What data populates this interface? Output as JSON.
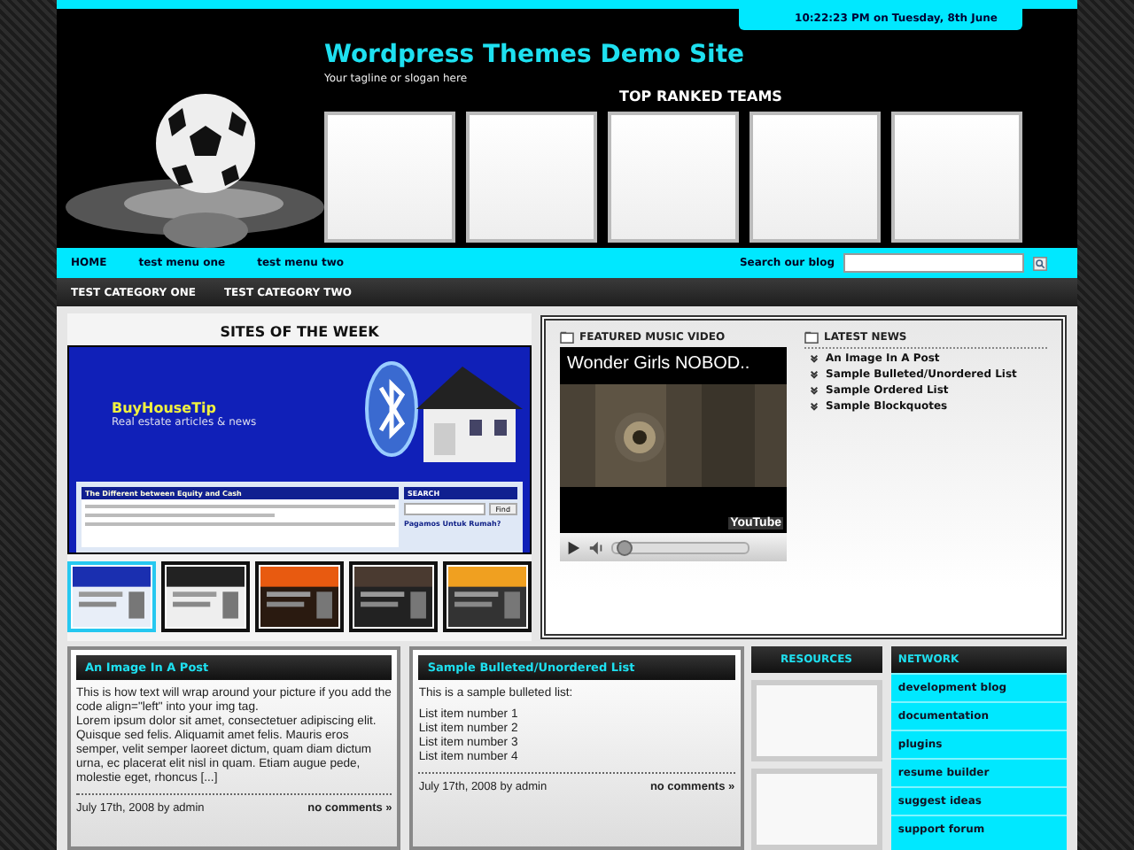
{
  "header": {
    "time": "10:22:23 PM on Tuesday, 8th June",
    "title": "Wordpress Themes Demo Site",
    "tagline": "Your tagline or slogan here",
    "teams_heading": "TOP RANKED TEAMS",
    "teams": [
      {
        "kind": "empty"
      },
      {
        "kind": "empty"
      },
      {
        "kind": "empty"
      },
      {
        "kind": "empty"
      },
      {
        "kind": "empty"
      }
    ]
  },
  "nav": {
    "items": [
      "HOME",
      "test menu one",
      "test menu two"
    ],
    "search_label": "Search our blog"
  },
  "categories": [
    "TEST CATEGORY ONE",
    "TEST CATEGORY TWO"
  ],
  "sites": {
    "heading": "SITES OF THE WEEK",
    "featured": {
      "site_title": "BuyHouseTip",
      "site_tagline": "Real estate articles & news",
      "post_title": "The Different between Equity and Cash",
      "search_label": "SEARCH",
      "search_button": "Find",
      "sidebar_link": "Pagamos Untuk Rumah?"
    },
    "thumbnails": [
      {
        "kind": "blue",
        "selected": true
      },
      {
        "kind": "light",
        "selected": false
      },
      {
        "kind": "orange",
        "selected": false
      },
      {
        "kind": "dark",
        "selected": false
      },
      {
        "kind": "yellow",
        "selected": false
      }
    ]
  },
  "video": {
    "heading": "FEATURED MUSIC VIDEO",
    "title": "Wonder Girls NOBOD..",
    "logo": "YouTube",
    "level": 0.03
  },
  "news": {
    "heading": "LATEST NEWS",
    "items": [
      "An Image In A Post",
      "Sample Bulleted/Unordered List",
      "Sample Ordered List",
      "Sample Blockquotes"
    ]
  },
  "posts": [
    {
      "title": "An Image In A Post",
      "paragraphs": [
        "This is how text will wrap around your picture if you add the code align=\"left\" into your img tag.",
        "Lorem ipsum dolor sit amet, consectetuer adipiscing elit. Quisque sed felis. Aliquamit amet felis. Mauris eros semper, velit semper laoreet dictum, quam diam dictum urna, ec placerat elit nisl in quam. Etiam augue pede, molestie eget, rhoncus [...]"
      ],
      "meta": "July 17th, 2008 by admin",
      "comments": "no comments »"
    },
    {
      "title": "Sample Bulleted/Unordered List",
      "paragraphs": [
        "This is a sample bulleted list:"
      ],
      "list": [
        "List item number 1",
        "List item number 2",
        "List item number 3",
        "List item number 4"
      ],
      "meta": "July 17th, 2008 by admin",
      "comments": "no comments »"
    }
  ],
  "resources": {
    "heading": "RESOURCES"
  },
  "network": {
    "heading": "NETWORK",
    "items": [
      "development blog",
      "documentation",
      "plugins",
      "resume builder",
      "suggest ideas",
      "support forum"
    ]
  }
}
